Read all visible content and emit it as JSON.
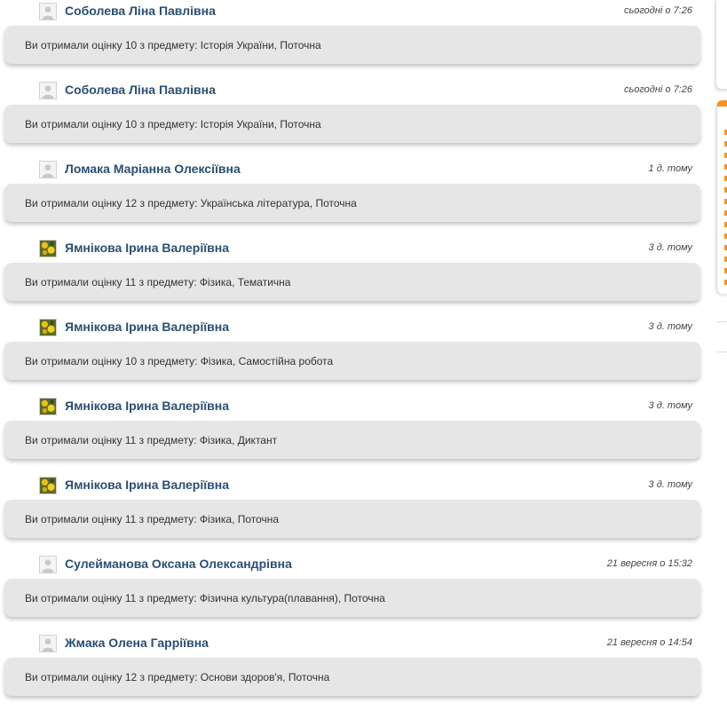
{
  "notifications": [
    {
      "author": "Соболева Ліна Павлівна",
      "time": "сьогодні о 7:26",
      "message": "Ви отримали оцінку 10 з предмету: Історія України, Поточна",
      "avatar": "default"
    },
    {
      "author": "Соболева Ліна Павлівна",
      "time": "сьогодні о 7:26",
      "message": "Ви отримали оцінку 10 з предмету: Історія України, Поточна",
      "avatar": "default"
    },
    {
      "author": "Ломака Маріанна Олексіївна",
      "time": "1 д. тому",
      "message": "Ви отримали оцінку 12 з предмету: Українська література, Поточна",
      "avatar": "default"
    },
    {
      "author": "Ямнікова Ірина Валеріївна",
      "time": "3 д. тому",
      "message": "Ви отримали оцінку 11 з предмету: Фізика, Тематична",
      "avatar": "photo"
    },
    {
      "author": "Ямнікова Ірина Валеріївна",
      "time": "3 д. тому",
      "message": "Ви отримали оцінку 10 з предмету: Фізика, Самостійна робота",
      "avatar": "photo"
    },
    {
      "author": "Ямнікова Ірина Валеріївна",
      "time": "3 д. тому",
      "message": "Ви отримали оцінку 11 з предмету: Фізика, Диктант",
      "avatar": "photo"
    },
    {
      "author": "Ямнікова Ірина Валеріївна",
      "time": "3 д. тому",
      "message": "Ви отримали оцінку 11 з предмету: Фізика, Поточна",
      "avatar": "photo"
    },
    {
      "author": "Сулейманова Оксана Олександрівна",
      "time": "21 вересня о 15:32",
      "message": "Ви отримали оцінку 11 з предмету: Фізична культура(плавання), Поточна",
      "avatar": "default"
    },
    {
      "author": "Жмака Олена Гарріївна",
      "time": "21 вересня о 14:54",
      "message": "Ви отримали оцінку 12 з предмету: Основи здоров'я, Поточна",
      "avatar": "default"
    }
  ],
  "colors": {
    "author": "#2c4e73",
    "bubble": "#e6e6e6",
    "accent": "#f7941d"
  }
}
